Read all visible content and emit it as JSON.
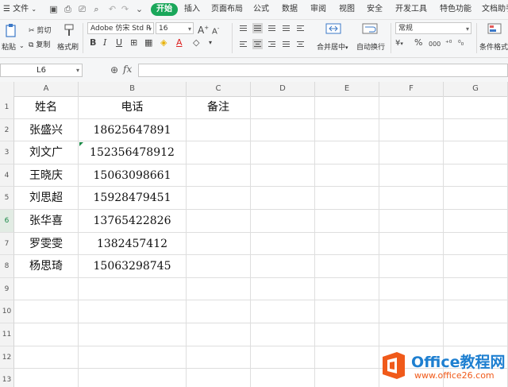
{
  "menubar": {
    "file_menu": "文件",
    "tabs": [
      {
        "label": "开始",
        "active": true
      },
      {
        "label": "插入"
      },
      {
        "label": "页面布局"
      },
      {
        "label": "公式"
      },
      {
        "label": "数据"
      },
      {
        "label": "审阅"
      },
      {
        "label": "视图"
      },
      {
        "label": "安全"
      },
      {
        "label": "开发工具"
      },
      {
        "label": "特色功能"
      },
      {
        "label": "文档助手"
      }
    ]
  },
  "ribbon": {
    "cut": "剪切",
    "paste": "粘贴",
    "copy": "复制",
    "format_painter": "格式刷",
    "font_name": "Adobe 仿宋 Std R",
    "font_size": "16",
    "bold": "B",
    "italic": "I",
    "underline": "U",
    "grow_font": "A",
    "shrink_font": "A",
    "merge_center": "合并居中",
    "wrap_text": "自动换行",
    "number_format": "常规",
    "currency": "¥",
    "percent": "%",
    "thousands": "000",
    "conditional_format": "条件格式"
  },
  "formula_bar": {
    "cell_ref": "L6",
    "fx": "fx",
    "value": ""
  },
  "sheet": {
    "columns": [
      "A",
      "B",
      "C",
      "D",
      "E",
      "F",
      "G"
    ],
    "rows": [
      "1",
      "2",
      "3",
      "4",
      "5",
      "6",
      "7",
      "8",
      "9",
      "10",
      "11",
      "12",
      "13"
    ],
    "selected_row": "6",
    "cells": [
      [
        "姓名",
        "电话",
        "备注"
      ],
      [
        "张盛兴",
        "18625647891",
        ""
      ],
      [
        "刘文广",
        "152356478912",
        ""
      ],
      [
        "王晓庆",
        "15063098661",
        ""
      ],
      [
        "刘思超",
        "15928479451",
        ""
      ],
      [
        "张华喜",
        "13765422826",
        ""
      ],
      [
        "罗雯雯",
        "1382457412",
        ""
      ],
      [
        "杨思琦",
        "15063298745",
        ""
      ]
    ]
  },
  "watermark": {
    "title": "Office教程网",
    "url": "www.office26.com",
    "colors": {
      "orange": "#f05a1a",
      "blue": "#1e7fd0"
    }
  },
  "theme": {
    "accent": "#1aa75a"
  }
}
